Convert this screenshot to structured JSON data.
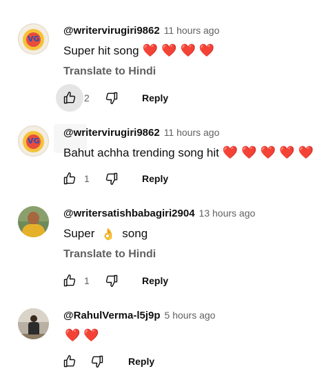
{
  "comments": [
    {
      "author": "@writervirugiri9862",
      "time": "11 hours ago",
      "text": "Super hit song",
      "hearts": [
        "❤️",
        "❤️",
        "❤️",
        "❤️"
      ],
      "translate": "Translate to Hindi",
      "likes": "2",
      "reply": "Reply"
    },
    {
      "author": "@writervirugiri9862",
      "time": "11 hours ago",
      "text": "Bahut achha trending song hit",
      "hearts": [
        "❤️",
        "❤️",
        "❤️",
        "❤️",
        "❤️"
      ],
      "likes": "1",
      "reply": "Reply"
    },
    {
      "author": "@writersatishbabagiri2904",
      "time": "13 hours ago",
      "text_before": "Super",
      "emoji": "👌",
      "text_after": "song",
      "translate": "Translate to Hindi",
      "likes": "1",
      "reply": "Reply"
    },
    {
      "author": "@RahulVerma-l5j9p",
      "time": "5 hours ago",
      "hearts": [
        "❤️",
        "❤️"
      ],
      "reply": "Reply"
    }
  ],
  "avatar_logo_text": "VG",
  "icons": [
    "like-icon",
    "dislike-icon"
  ]
}
